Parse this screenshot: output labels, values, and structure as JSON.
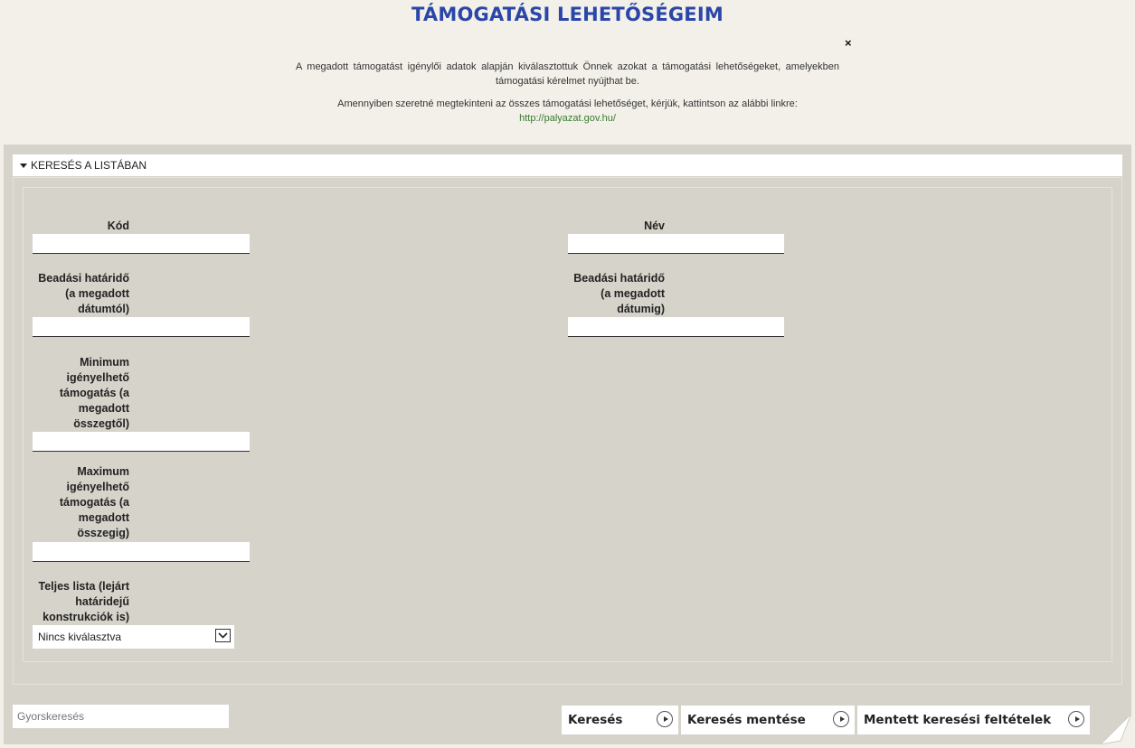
{
  "page": {
    "title": "TÁMOGATÁSI LEHETŐSÉGEIM",
    "close_symbol": "×",
    "intro_text_1": "A megadott támogatást igénylői adatok alapján kiválasztottuk Önnek azokat a támogatási lehetőségeket, amelyekben támogatási kérelmet nyújthat be.",
    "intro_text_2": "Amennyiben szeretné megtekinteni az összes támogatási lehetőséget, kérjük, kattintson az alábbi linkre:",
    "link_text": "http://palyazat.gov.hu/"
  },
  "search_section": {
    "header": "KERESÉS A LISTÁBAN",
    "fields": {
      "kod_label": "Kód",
      "kod_value": "",
      "nev_label": "Név",
      "nev_value": "",
      "beadasi_tol_label": "Beadási határidő (a megadott dátumtól)",
      "beadasi_tol_value": "",
      "beadasi_ig_label": "Beadási határidő (a megadott dátumig)",
      "beadasi_ig_value": "",
      "min_label": "Minimum igényelhető támogatás (a megadott összegtől)",
      "min_value": "",
      "max_label": "Maximum igényelhető támogatás (a megadott összegig)",
      "max_value": "",
      "teljes_lista_label": "Teljes lista (lejárt határidejű konstrukciók is)",
      "teljes_lista_selected": "Nincs kiválasztva"
    }
  },
  "footer": {
    "quick_search_placeholder": "Gyorskeresés",
    "buttons": {
      "search": "Keresés",
      "save_search": "Keresés mentése",
      "saved_criteria": "Mentett keresési feltételek"
    }
  },
  "colors": {
    "title": "#2a46a8",
    "link": "#3a7a2e",
    "panel": "#d6d3ca",
    "background": "#f2f0e9"
  }
}
